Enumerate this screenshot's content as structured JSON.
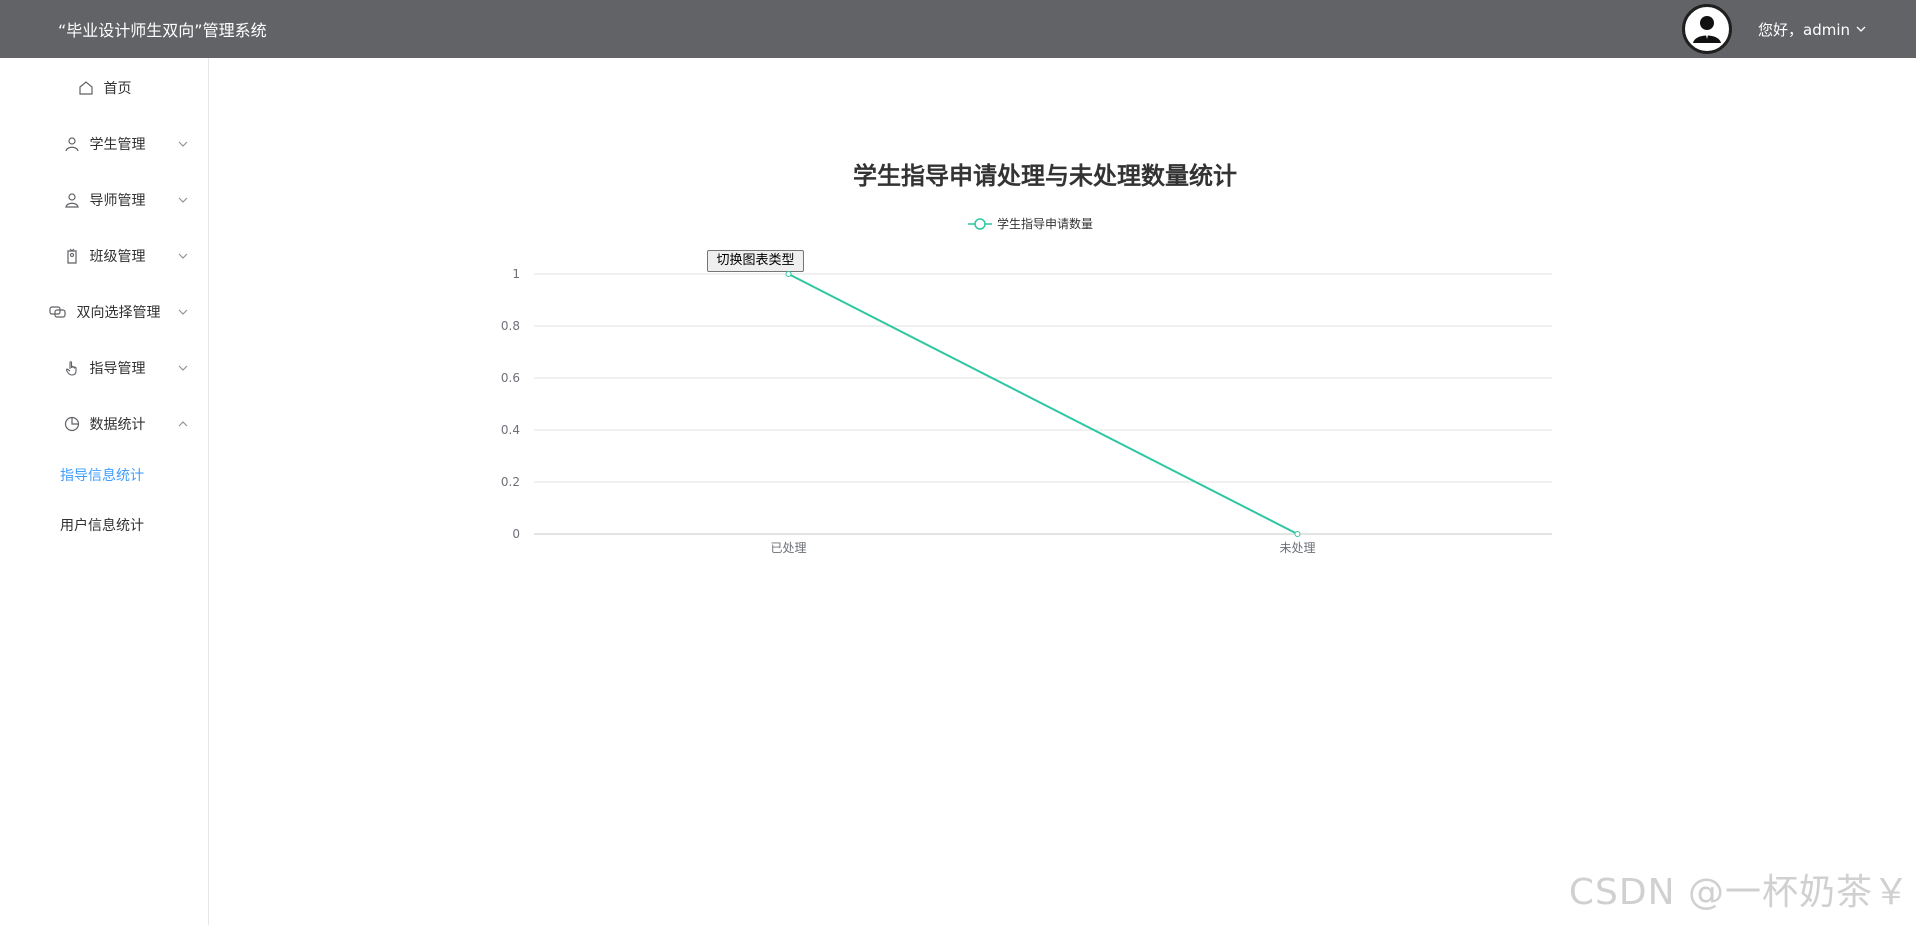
{
  "header": {
    "app_title": "“毕业设计师生双向”管理系统",
    "greeting": "您好，admin"
  },
  "sidebar": {
    "items": [
      {
        "label": "首页",
        "icon": "home-icon",
        "has_arrow": false
      },
      {
        "label": "学生管理",
        "icon": "user-icon",
        "has_arrow": true,
        "expanded": false
      },
      {
        "label": "导师管理",
        "icon": "teacher-icon",
        "has_arrow": true,
        "expanded": false
      },
      {
        "label": "班级管理",
        "icon": "tag-icon",
        "has_arrow": true,
        "expanded": false
      },
      {
        "label": "双向选择管理",
        "icon": "connection-icon",
        "has_arrow": true,
        "expanded": false
      },
      {
        "label": "指导管理",
        "icon": "hand-icon",
        "has_arrow": true,
        "expanded": false
      },
      {
        "label": "数据统计",
        "icon": "pie-chart-icon",
        "has_arrow": true,
        "expanded": true
      }
    ],
    "subitems": [
      {
        "label": "指导信息统计",
        "active": true
      },
      {
        "label": "用户信息统计",
        "active": false
      }
    ]
  },
  "main": {
    "switch_button_label": "切换图表类型"
  },
  "chart_data": {
    "type": "line",
    "title": "学生指导申请处理与未处理数量统计",
    "categories": [
      "已处理",
      "未处理"
    ],
    "series": [
      {
        "name": "学生指导申请数量",
        "values": [
          1,
          0
        ],
        "color": "#2ec7a1"
      }
    ],
    "ylim": [
      0,
      1
    ],
    "yticks": [
      "1",
      "0.8",
      "0.6",
      "0.4",
      "0.2",
      "0"
    ],
    "legend_position": "top-center",
    "grid": true
  },
  "watermark": "CSDN @一杯奶茶￥"
}
